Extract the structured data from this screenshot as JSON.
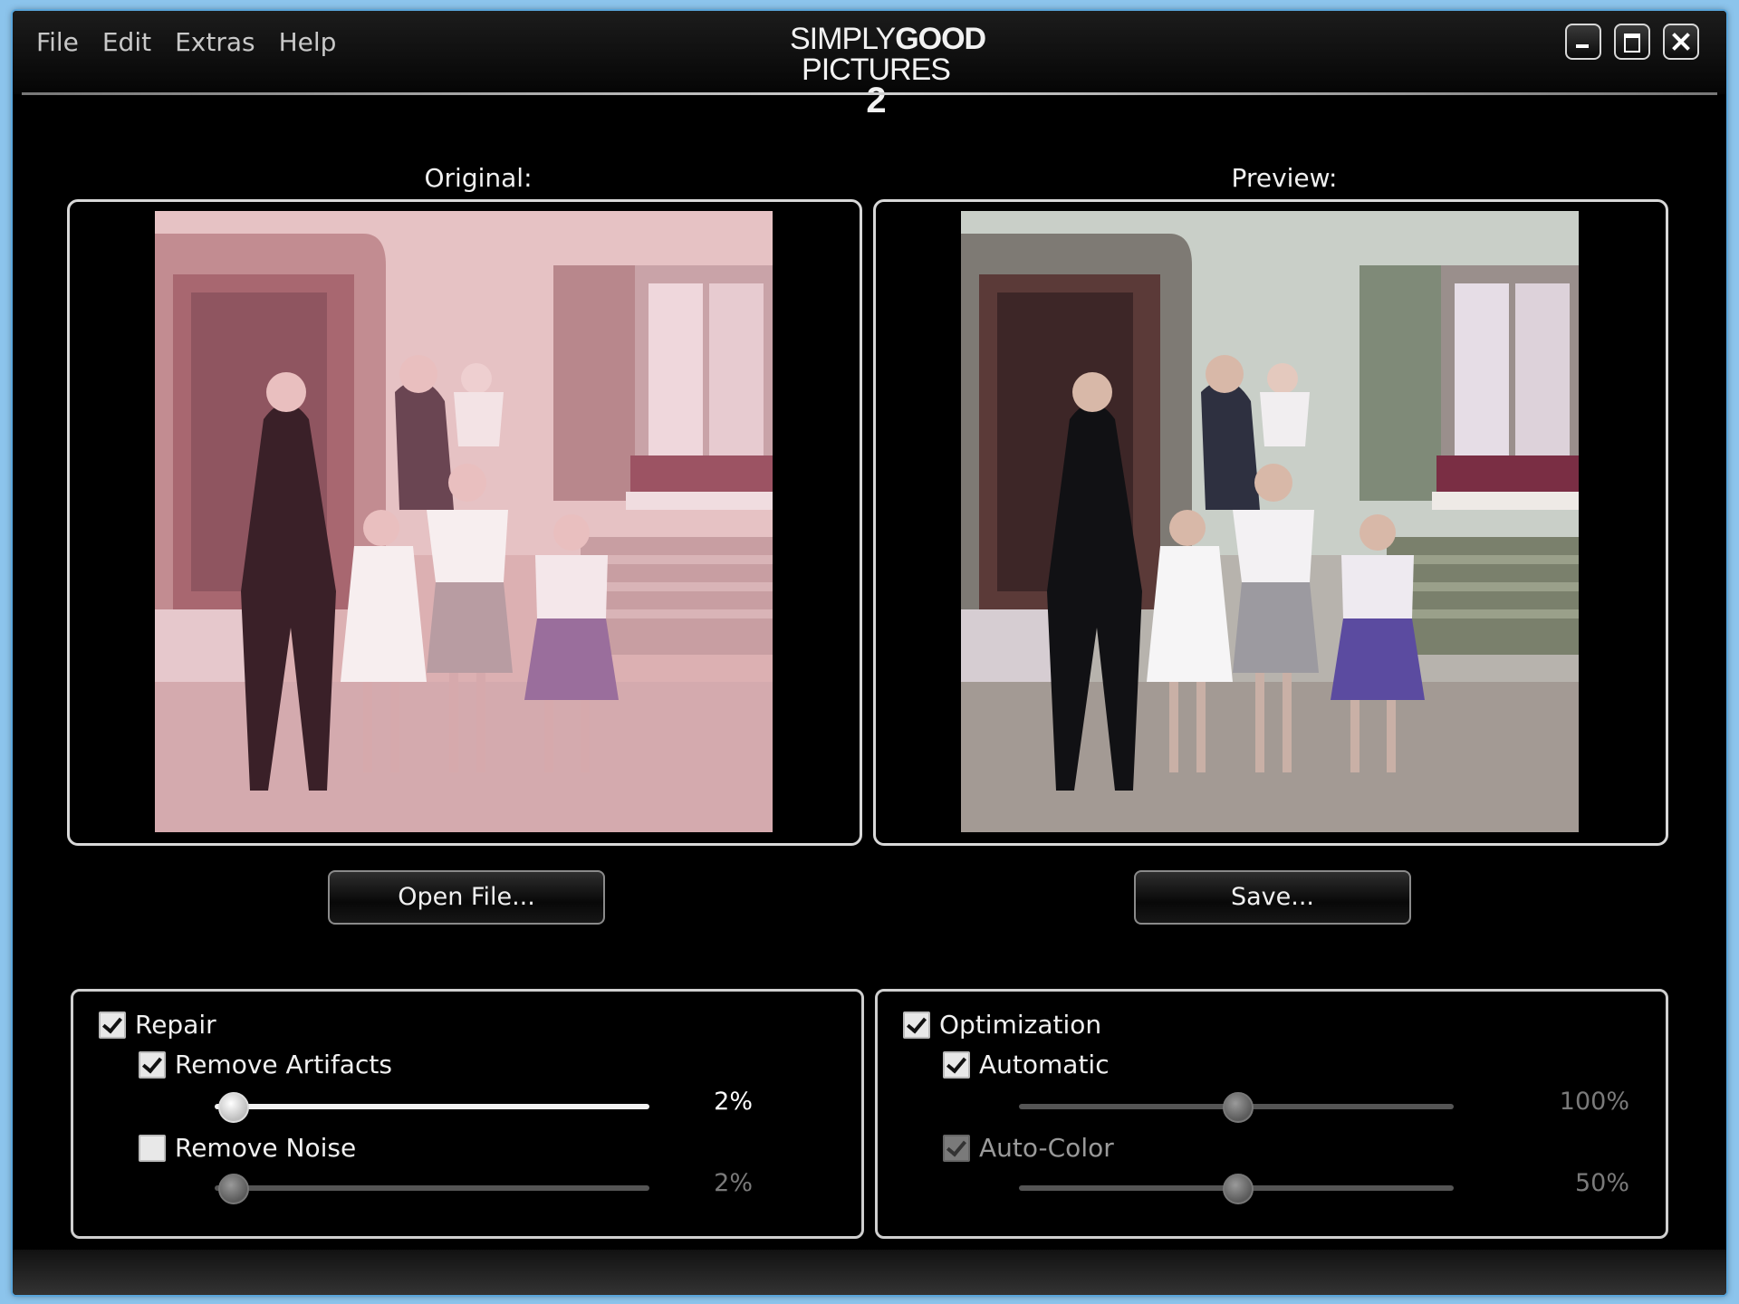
{
  "menu": [
    "File",
    "Edit",
    "Extras",
    "Help"
  ],
  "brand": {
    "word1": "SIMPLY",
    "word2": "GOOD",
    "word3": "PICTURES",
    "number": "2"
  },
  "panels": {
    "original_label": "Original:",
    "preview_label": "Preview:"
  },
  "buttons": {
    "open": "Open File...",
    "save": "Save..."
  },
  "repair": {
    "label": "Repair",
    "checked": true,
    "remove_artifacts": {
      "label": "Remove Artifacts",
      "checked": true,
      "value": "2%",
      "level": 0.02
    },
    "remove_noise": {
      "label": "Remove Noise",
      "checked": false,
      "value": "2%",
      "level": 0.02
    }
  },
  "optimization": {
    "label": "Optimization",
    "checked": true,
    "automatic": {
      "label": "Automatic",
      "checked": true,
      "value": "100%",
      "level": 0.5
    },
    "auto_color": {
      "label": "Auto-Color",
      "checked": true,
      "value": "50%",
      "level": 0.5
    }
  },
  "colors": {
    "window_bg": "#000000",
    "outer_bg": "#8cc4ec",
    "original_tint": "#d99aa0"
  }
}
